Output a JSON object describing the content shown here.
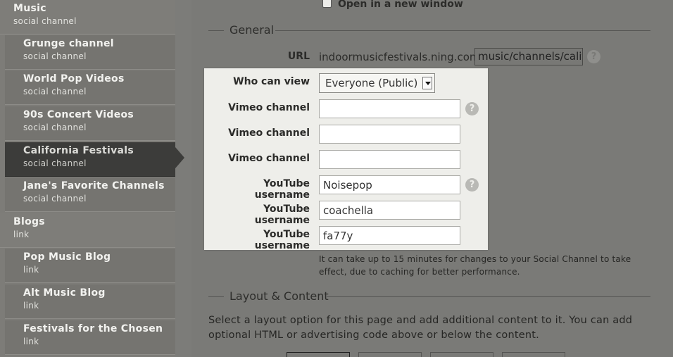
{
  "sidebar": {
    "items": [
      {
        "title": "Music",
        "subtitle": "social channel",
        "level": "top"
      },
      {
        "title": "Grunge channel",
        "subtitle": "social channel",
        "level": "sub"
      },
      {
        "title": "World Pop Videos",
        "subtitle": "social channel",
        "level": "sub"
      },
      {
        "title": "90s Concert Videos",
        "subtitle": "social channel",
        "level": "sub"
      },
      {
        "title": "California Festivals",
        "subtitle": "social channel",
        "level": "sub",
        "active": true
      },
      {
        "title": "Jane's Favorite Channels",
        "subtitle": "social channel",
        "level": "sub"
      },
      {
        "title": "Blogs",
        "subtitle": "link",
        "level": "top"
      },
      {
        "title": "Pop Music Blog",
        "subtitle": "link",
        "level": "sub"
      },
      {
        "title": "Alt Music Blog",
        "subtitle": "link",
        "level": "sub"
      },
      {
        "title": "Festivals for the Chosen",
        "subtitle": "link",
        "level": "sub"
      }
    ]
  },
  "main": {
    "open_new_window_label": "Open in a new window",
    "general_title": "General",
    "url_label": "URL",
    "url_prefix": "indoormusicfestivals.ning.com/",
    "url_value": "music/channels/california-festivals",
    "who_can_view_label": "Who can view",
    "who_can_view_value": "Everyone (Public)",
    "vimeo_label": "Vimeo channel",
    "vimeo_values": [
      "",
      "",
      ""
    ],
    "youtube_label": "YouTube username",
    "youtube_values": [
      "Noisepop",
      "coachella",
      "fa77y"
    ],
    "help_glyph": "?",
    "note": "It can take up to 15 minutes for changes to your Social Channel to take effect, due to caching for better performance.",
    "layout_title": "Layout & Content",
    "layout_description": "Select a layout option for this page and add additional content to it. You can add optional HTML or advertising code above or below the content."
  },
  "colors": {
    "page_bg": "#7a7a77",
    "sidebar_active": "#3c3c3a",
    "highlight_bg": "#eeeeea"
  }
}
